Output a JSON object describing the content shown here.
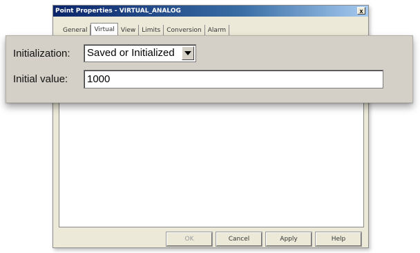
{
  "window": {
    "title": "Point Properties - VIRTUAL_ANALOG",
    "close_glyph": "x"
  },
  "tabs": [
    {
      "label": "General",
      "active": false
    },
    {
      "label": "Virtual",
      "active": true
    },
    {
      "label": "View",
      "active": false
    },
    {
      "label": "Limits",
      "active": false
    },
    {
      "label": "Conversion",
      "active": false
    },
    {
      "label": "Alarm",
      "active": false
    }
  ],
  "buttons": {
    "ok": "OK",
    "cancel": "Cancel",
    "apply": "Apply",
    "help": "Help"
  },
  "fields": {
    "initialization_label": "Initialization:",
    "initialization_value": "Saved or Initialized",
    "initial_value_label": "Initial value:",
    "initial_value_value": "1000"
  },
  "colors": {
    "window_bg": "#ece9d8",
    "title_bar": "#0a246a",
    "callout_bg": "#d4d0c8"
  },
  "icons": {
    "dropdown": "triangle-down-icon",
    "close": "close-icon"
  }
}
